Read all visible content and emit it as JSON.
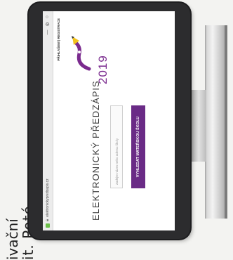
{
  "page_text": {
    "line1": "ivační",
    "line2": "it. Poté"
  },
  "browser": {
    "url": "elektronickypredzapis.cz",
    "icons": [
      "minimize-icon",
      "settings-icon",
      "close-icon"
    ]
  },
  "site": {
    "top_links": "PŘIHLÁŠENÍ | REGISTRACE",
    "title": "ELEKTRONICKÝ PŘEDZÁPIS",
    "year": "2019",
    "search_placeholder": "Zadejte název nebo adresu školy",
    "cta_label": "VYHLEDAT MATEŘSKOU ŠKOLU"
  },
  "colors": {
    "brand_purple": "#6a2b86",
    "year_purple": "#7a2a8e",
    "pencil_yellow": "#f2c21b",
    "tab_green": "#6cc04a"
  }
}
